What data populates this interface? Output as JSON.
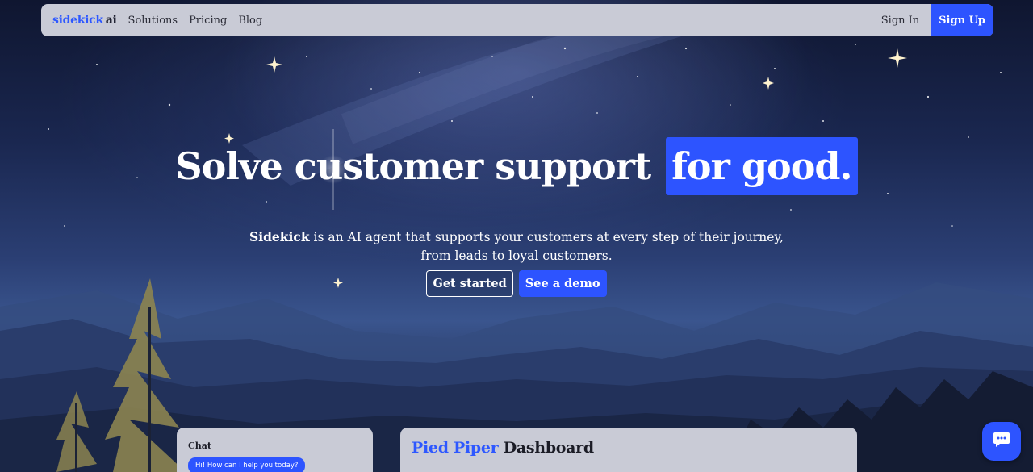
{
  "nav": {
    "logo_brand": "sidekick",
    "logo_suffix": "ai",
    "links": [
      "Solutions",
      "Pricing",
      "Blog"
    ],
    "signin_label": "Sign In",
    "signup_label": "Sign Up"
  },
  "hero": {
    "title_plain": "Solve customer support",
    "title_highlight": "for good.",
    "subtitle_bold": "Sidekick",
    "subtitle_rest": " is an AI agent that supports your customers at every step of their journey, from leads to loyal customers.",
    "cta_primary": "Get started",
    "cta_secondary": "See a demo"
  },
  "chat_preview": {
    "title": "Chat",
    "message": "Hi! How can I help you today?"
  },
  "dashboard_preview": {
    "brand": "Pied Piper",
    "title_rest": "Dashboard"
  },
  "chat_launcher": {
    "icon": "chat-bubble-icon"
  },
  "colors": {
    "accent": "#2d54ff",
    "card": "#c9cbd6",
    "text_dark": "#1b1c26"
  }
}
